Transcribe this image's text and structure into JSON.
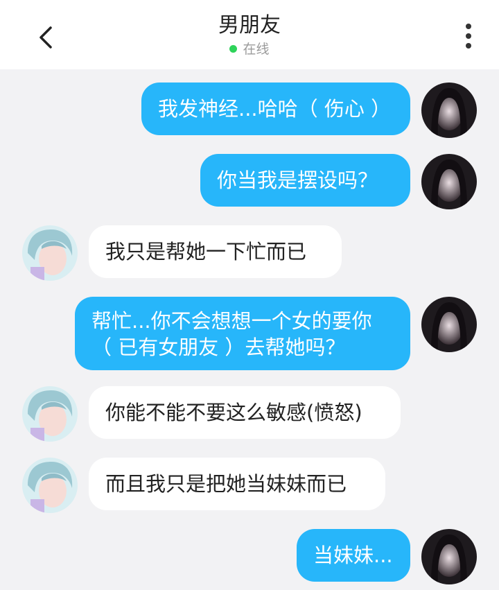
{
  "header": {
    "title": "男朋友",
    "status": "在线"
  },
  "colors": {
    "self_bubble": "#27b6fa",
    "other_bubble": "#ffffff",
    "online_dot": "#2ed35a",
    "background": "#f2f2f4"
  },
  "icons": [
    "chevron-left-icon",
    "more-vertical-icon"
  ],
  "messages": [
    {
      "sender": "self",
      "text": "我发神经...哈哈（ 伤心 ）"
    },
    {
      "sender": "self",
      "text": "你当我是摆设吗？"
    },
    {
      "sender": "other",
      "text": "我只是帮她一下忙而已"
    },
    {
      "sender": "self",
      "lines": [
        "帮忙...你不会想想一个女的要你",
        "（ 已有女朋友 ）去帮她吗？"
      ]
    },
    {
      "sender": "other",
      "text": "你能不能不要这么敏感(愤怒)"
    },
    {
      "sender": "other",
      "text": "而且我只是把她当妹妹而已"
    },
    {
      "sender": "self",
      "text": "当妹妹..."
    }
  ]
}
